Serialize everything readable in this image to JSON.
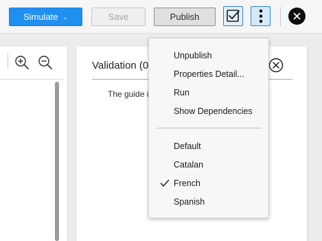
{
  "toolbar": {
    "simulate_label": "Simulate",
    "simulate_caret": "chevron-down-icon",
    "save_label": "Save",
    "publish_label": "Publish",
    "validate_icon": "checkbox-check-icon",
    "more_icon": "vertical-ellipsis-icon",
    "close_icon": "close-circle-icon",
    "accent_color": "#1f8ff0"
  },
  "left_panel": {
    "zoom_in_icon": "zoom-in-icon",
    "zoom_out_icon": "zoom-out-icon"
  },
  "validation_panel": {
    "title": "Validation (0",
    "message": "The guide i",
    "close_icon": "close-circle-outline-icon"
  },
  "menu": {
    "actions": [
      {
        "label": "Unpublish"
      },
      {
        "label": "Properties Detail..."
      },
      {
        "label": "Run"
      },
      {
        "label": "Show Dependencies"
      }
    ],
    "languages": [
      {
        "label": "Default",
        "checked": false
      },
      {
        "label": "Catalan",
        "checked": false
      },
      {
        "label": "French",
        "checked": true
      },
      {
        "label": "Spanish",
        "checked": false
      }
    ]
  }
}
